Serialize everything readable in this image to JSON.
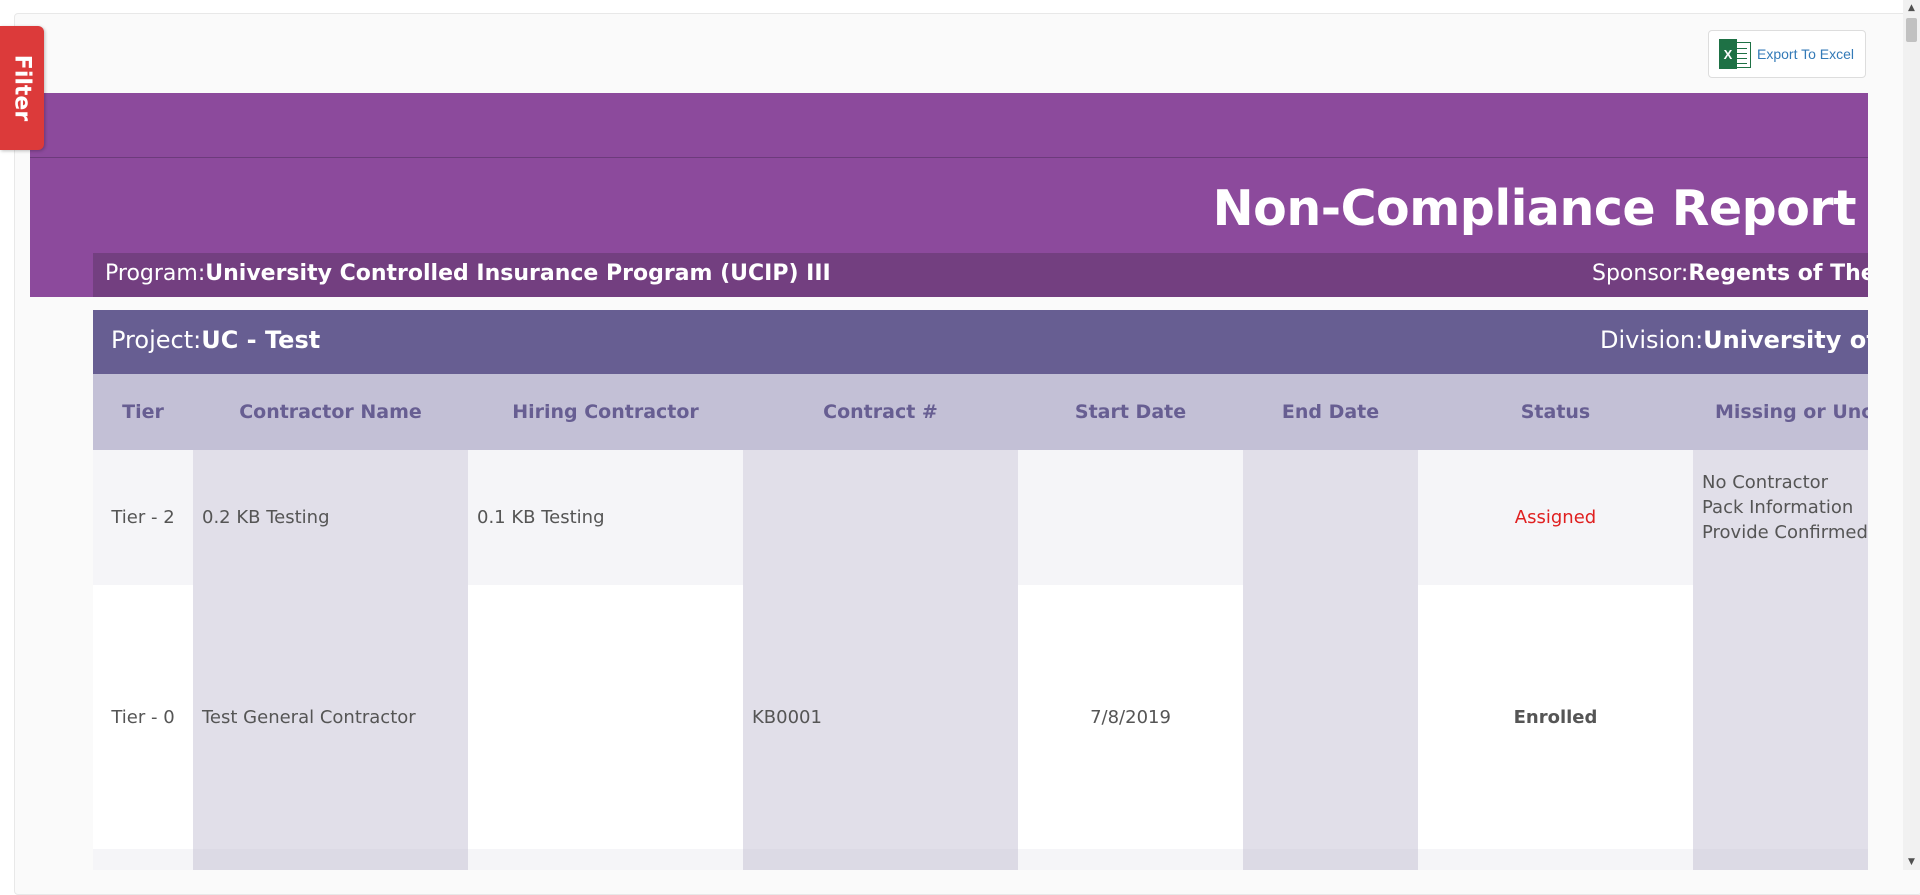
{
  "filter": {
    "label": "Filter"
  },
  "export": {
    "label": "Export To Excel",
    "icon": "excel-icon",
    "icon_letter": "X"
  },
  "report": {
    "title": "Non-Compliance Report"
  },
  "program": {
    "label": "Program:",
    "value": "University Controlled Insurance Program (UCIP) III",
    "sponsor_label": "Sponsor:",
    "sponsor_value": "Regents of The U"
  },
  "project": {
    "label": "Project:",
    "value": "UC - Test",
    "division_label": "Division:",
    "division_value": "University of Ca"
  },
  "table": {
    "headers": [
      "Tier",
      "Contractor Name",
      "Hiring Contractor",
      "Contract #",
      "Start Date",
      "End Date",
      "Status",
      "Missing or Unco"
    ],
    "rows": [
      {
        "tier": "Tier - 2",
        "contractor": "0.2 KB Testing",
        "hiring": "0.1 KB Testing",
        "contract": "",
        "start": "",
        "end": "",
        "status": "Assigned",
        "missing": "No Contractor Pack Information Provide Confirmed"
      },
      {
        "tier": "Tier - 0",
        "contractor": "Test General Contractor",
        "hiring": "",
        "contract": "KB0001",
        "start": "7/8/2019",
        "end": "",
        "status": "Enrolled",
        "missing": ""
      },
      {
        "tier": "",
        "contractor": "",
        "hiring": "",
        "contract": "",
        "start": "",
        "end": "",
        "status": "",
        "missing": ""
      }
    ]
  },
  "colors": {
    "purple_band": "#8c4a9c",
    "program_bar": "#733f80",
    "project_bar": "#675e92",
    "header_bg": "#c3c0d6",
    "filter_red": "#dc3a3a",
    "status_assigned": "#e02020"
  }
}
